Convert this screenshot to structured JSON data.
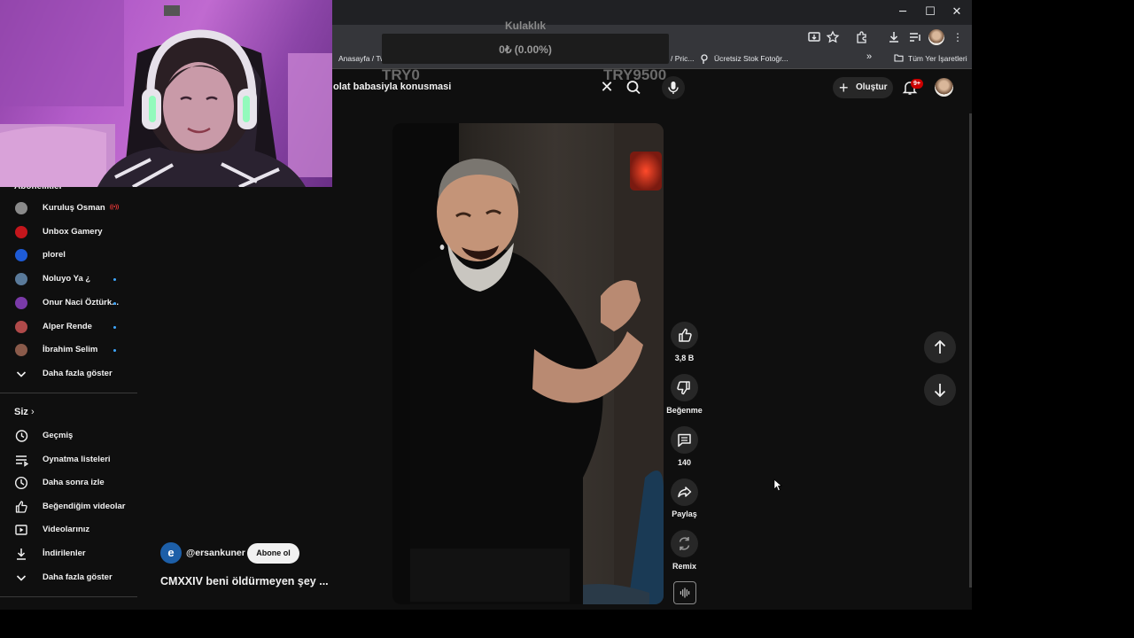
{
  "window": {
    "minimize_icon": "minimize-icon",
    "maximize_icon": "maximize-icon",
    "close_icon": "close-icon"
  },
  "bookmarks": {
    "items": [
      {
        "label": "Anasayfa / Tw"
      },
      {
        "label": "/ Pric..."
      },
      {
        "label": "Ücretsiz Stok Fotoğr..."
      }
    ],
    "overflow": "»",
    "all_bookmarks": "Tüm Yer İşaretleri"
  },
  "donation": {
    "title": "Kulaklık",
    "value": "0₺ (0.00%)",
    "progress": 0.0,
    "min": "TRY0",
    "max": "TRY9500"
  },
  "header": {
    "search_query": "olat babasiyla konusmasi",
    "clear": "✕",
    "create_label": "Oluştur",
    "notification_count": "9+"
  },
  "sidebar": {
    "subscriptions_heading": "Abonelikler",
    "subscriptions": [
      {
        "label": "Kuruluş Osman",
        "status": "live",
        "color": "#8a8a8a"
      },
      {
        "label": "Unbox Gamery",
        "status": "",
        "color": "#c4161c"
      },
      {
        "label": "plorel",
        "status": "",
        "color": "#1e5bd6"
      },
      {
        "label": "Noluyo Ya ¿",
        "status": "new",
        "color": "#5a7a9a"
      },
      {
        "label": "Onur Naci Öztürk...",
        "status": "new",
        "color": "#7a3aa8"
      },
      {
        "label": "Alper Rende",
        "status": "new",
        "color": "#b04a4a"
      },
      {
        "label": "İbrahim Selim",
        "status": "new",
        "color": "#8a5a4a"
      }
    ],
    "show_more": "Daha fazla göster",
    "you_heading": "Siz",
    "you_items": [
      {
        "label": "Geçmiş",
        "icon": "history-icon"
      },
      {
        "label": "Oynatma listeleri",
        "icon": "playlist-icon"
      },
      {
        "label": "Daha sonra izle",
        "icon": "clock-icon"
      },
      {
        "label": "Beğendiğim videolar",
        "icon": "thumb-up-icon"
      },
      {
        "label": "Videolarınız",
        "icon": "video-icon"
      },
      {
        "label": "İndirilenler",
        "icon": "download-icon"
      }
    ],
    "you_show_more": "Daha fazla göster"
  },
  "short": {
    "channel_initial": "e",
    "channel": "@ersankuner",
    "subscribe": "Abone ol",
    "title": "CMXXIV beni öldürmeyen şey ..."
  },
  "actions": {
    "likes": "3,8 B",
    "dislike": "Beğenme",
    "comments": "140",
    "share": "Paylaş",
    "remix": "Remix"
  }
}
